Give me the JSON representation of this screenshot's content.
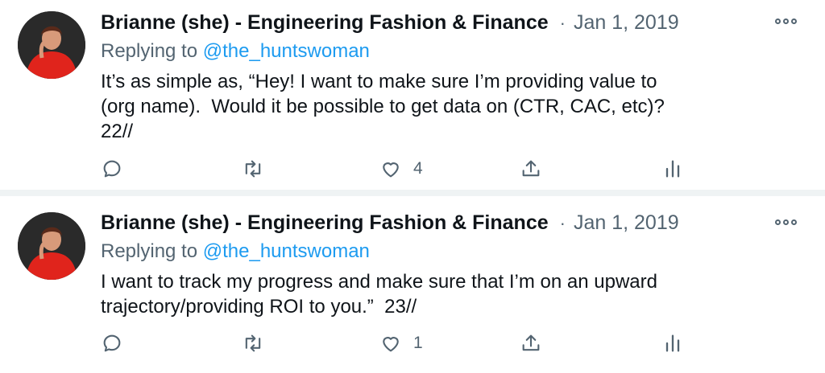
{
  "tweets": [
    {
      "author": "Brianne (she) - Engineering Fashion & Finance",
      "separator": "·",
      "date": "Jan 1, 2019",
      "reply_prefix": "Replying to",
      "reply_handle": "@the_huntswoman",
      "text": "It’s as simple as, “Hey! I want to make sure I’m providing value to\n(org name).  Would it be possible to get data on (CTR, CAC, etc)?\n22//",
      "likes": "4",
      "icons": [
        "reply-icon",
        "retweet-icon",
        "heart-icon",
        "share-icon",
        "analytics-icon",
        "more-icon"
      ]
    },
    {
      "author": "Brianne (she) - Engineering Fashion & Finance",
      "separator": "·",
      "date": "Jan 1, 2019",
      "reply_prefix": "Replying to",
      "reply_handle": "@the_huntswoman",
      "text": "I want to track my progress and make sure that I’m on an upward\ntrajectory/providing ROI to you.”  23//",
      "likes": "1",
      "icons": [
        "reply-icon",
        "retweet-icon",
        "heart-icon",
        "share-icon",
        "analytics-icon",
        "more-icon"
      ]
    }
  ],
  "colors": {
    "text": "#0f1419",
    "secondary": "#536471",
    "link": "#1d9bf0",
    "divider": "#eff3f4",
    "avatar_dress": "#e0241c"
  }
}
